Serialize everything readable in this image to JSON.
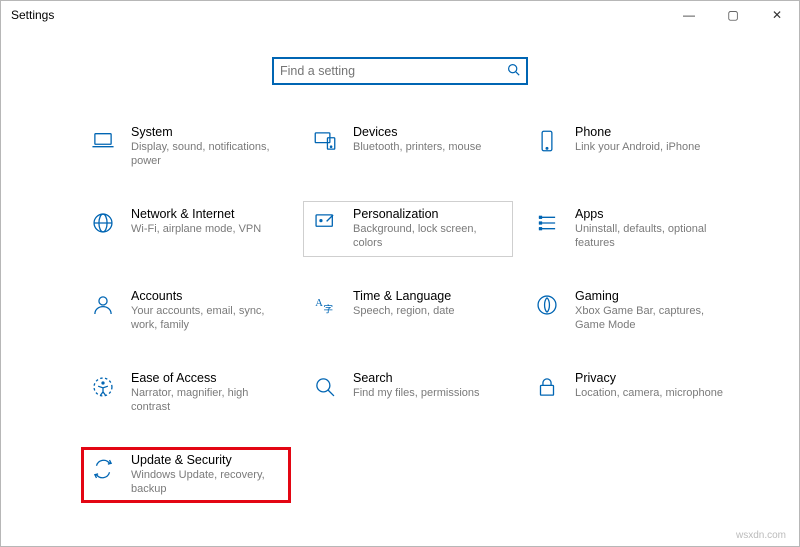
{
  "window": {
    "title": "Settings"
  },
  "controls": {
    "min": "—",
    "max": "▢",
    "close": "✕"
  },
  "search": {
    "placeholder": "Find a setting"
  },
  "tiles": {
    "system": {
      "title": "System",
      "desc": "Display, sound, notifications, power"
    },
    "devices": {
      "title": "Devices",
      "desc": "Bluetooth, printers, mouse"
    },
    "phone": {
      "title": "Phone",
      "desc": "Link your Android, iPhone"
    },
    "network": {
      "title": "Network & Internet",
      "desc": "Wi-Fi, airplane mode, VPN"
    },
    "personalization": {
      "title": "Personalization",
      "desc": "Background, lock screen, colors"
    },
    "apps": {
      "title": "Apps",
      "desc": "Uninstall, defaults, optional features"
    },
    "accounts": {
      "title": "Accounts",
      "desc": "Your accounts, email, sync, work, family"
    },
    "time": {
      "title": "Time & Language",
      "desc": "Speech, region, date"
    },
    "gaming": {
      "title": "Gaming",
      "desc": "Xbox Game Bar, captures, Game Mode"
    },
    "ease": {
      "title": "Ease of Access",
      "desc": "Narrator, magnifier, high contrast"
    },
    "search_tile": {
      "title": "Search",
      "desc": "Find my files, permissions"
    },
    "privacy": {
      "title": "Privacy",
      "desc": "Location, camera, microphone"
    },
    "update": {
      "title": "Update & Security",
      "desc": "Windows Update, recovery, backup"
    }
  },
  "watermark": "wsxdn.com"
}
